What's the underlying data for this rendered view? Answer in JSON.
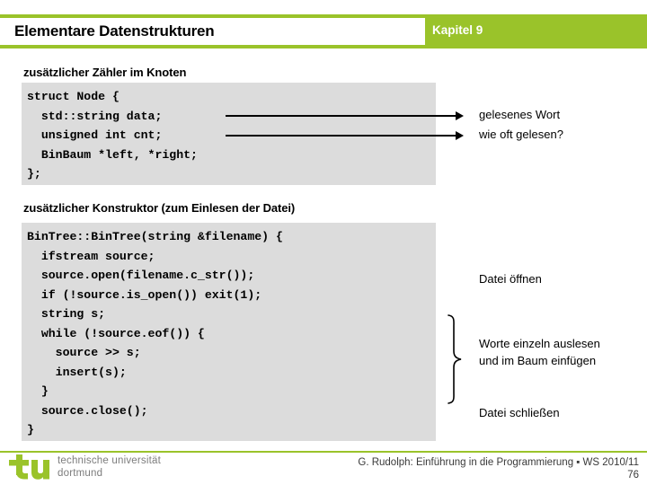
{
  "header": {
    "title": "Elementare Datenstrukturen",
    "chapter": "Kapitel 9",
    "band_color": "#9ac32a"
  },
  "sections": [
    {
      "heading": "zusätzlicher Zähler im Knoten",
      "code": "struct Node {\n  std::string data;\n  unsigned int cnt;\n  BinBaum *left, *right;\n};"
    },
    {
      "heading": "zusätzlicher Konstruktor (zum Einlesen der Datei)",
      "code": "BinTree::BinTree(string &filename) {\n  ifstream source;\n  source.open(filename.c_str());\n  if (!source.is_open()) exit(1);\n  string s;\n  while (!source.eof()) {\n    source >> s;\n    insert(s);\n  }\n  source.close();\n}"
    }
  ],
  "annotations": {
    "gelesenes_wort": "gelesenes Wort",
    "wie_oft_gelesen": "wie oft gelesen?",
    "datei_oeffnen": "Datei öffnen",
    "worte_einlesen": "Worte einzeln auslesen und im Baum einfügen",
    "datei_schliessen": "Datei schließen"
  },
  "footer": {
    "logo_mark": "tu",
    "logo_text": "technische universität\ndortmund",
    "credit": "G. Rudolph: Einführung in die Programmierung ▪ WS 2010/11",
    "page": "76",
    "rule_color": "#9ac32a",
    "logo_color": "#9ac32a"
  }
}
